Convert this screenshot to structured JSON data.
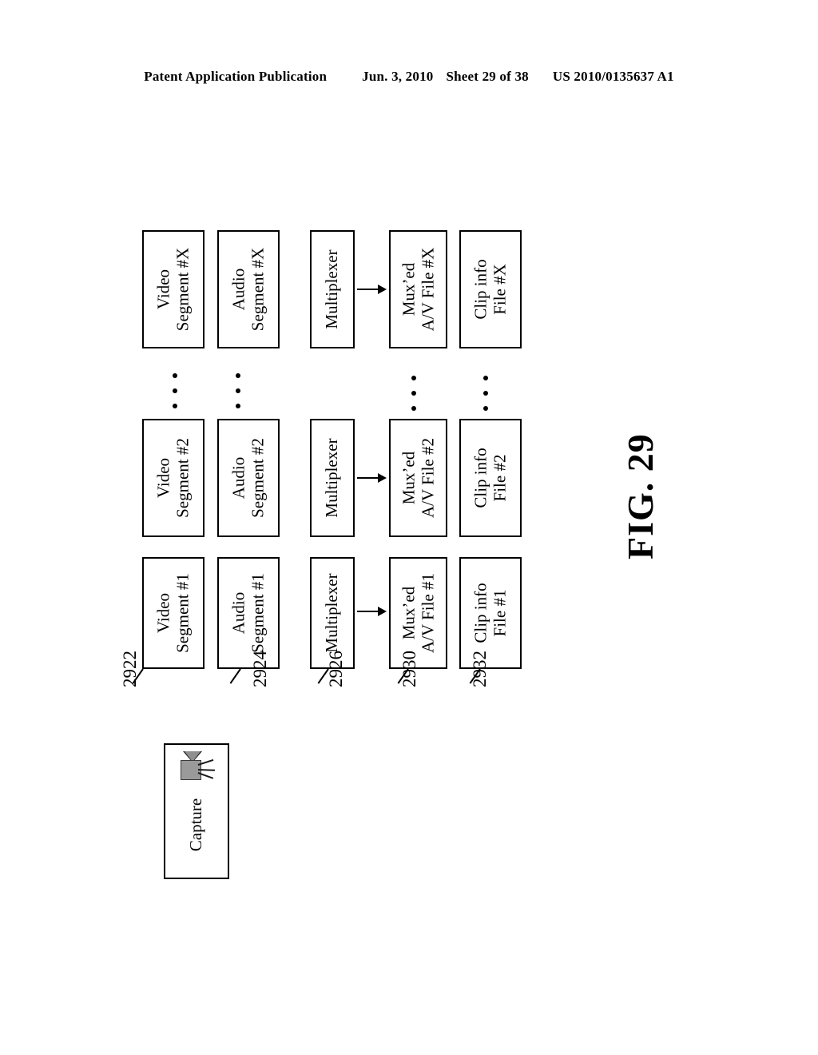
{
  "header": {
    "publication": "Patent Application Publication",
    "date": "Jun. 3, 2010",
    "sheet": "Sheet 29 of 38",
    "patent_number": "US 2010/0135637 A1"
  },
  "figure": {
    "caption": "FIG. 29"
  },
  "blocks": {
    "video_x": {
      "line1": "Video",
      "line2": "Segment #X"
    },
    "audio_x": {
      "line1": "Audio",
      "line2": "Segment #X"
    },
    "mux_x": {
      "line1": "Multiplexer",
      "line2": ""
    },
    "muxed_x": {
      "line1": "Mux’ed",
      "line2": "A/V File #X"
    },
    "clip_x": {
      "line1": "Clip info",
      "line2": "File #X"
    },
    "video_2": {
      "line1": "Video",
      "line2": "Segment #2"
    },
    "audio_2": {
      "line1": "Audio",
      "line2": "Segment #2"
    },
    "mux_2": {
      "line1": "Multiplexer",
      "line2": ""
    },
    "muxed_2": {
      "line1": "Mux’ed",
      "line2": "A/V File #2"
    },
    "clip_2": {
      "line1": "Clip info",
      "line2": "File #2"
    },
    "video_1": {
      "line1": "Video",
      "line2": "Segment #1"
    },
    "audio_1": {
      "line1": "Audio",
      "line2": "Segment #1"
    },
    "mux_1": {
      "line1": "Multiplexer",
      "line2": ""
    },
    "muxed_1": {
      "line1": "Mux’ed",
      "line2": "A/V File #1"
    },
    "clip_1": {
      "line1": "Clip info",
      "line2": "File #1"
    },
    "capture": {
      "line1": "Capture",
      "line2": ""
    }
  },
  "reference_numerals": {
    "video": "2922",
    "audio": "2924",
    "mux": "2926",
    "muxed": "2930",
    "clip": "2932"
  },
  "ellipses": {
    "count": 4,
    "dots_per_group": 3
  },
  "colors": {
    "ink": "#000000",
    "paper": "#ffffff",
    "icon_gray": "#9a9a9a"
  }
}
